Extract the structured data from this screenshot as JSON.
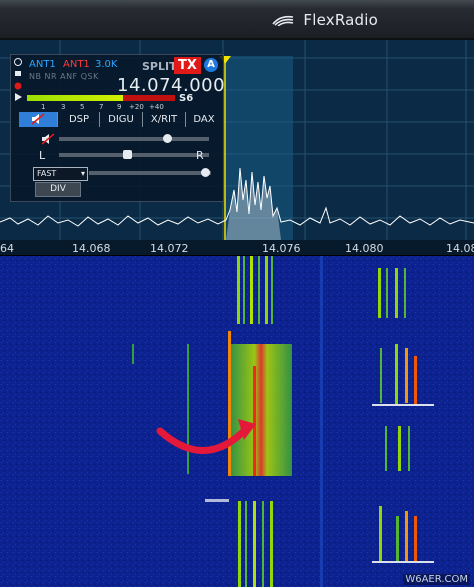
{
  "app": {
    "brand": "FlexRadio"
  },
  "slice": {
    "rx_ant": "ANT1",
    "tx_ant": "ANT1",
    "filter": "3.0K",
    "flags": "NB NR ANF QSK",
    "split_label": "SPLIT",
    "tx_label": "TX",
    "slice_letter": "A",
    "frequency": "14.074.000",
    "s_meter": "S6",
    "s_meter_fraction": 0.65,
    "meter_scale": [
      "1",
      "3",
      "5",
      "7",
      "9",
      "+20",
      "+40"
    ],
    "tabs": [
      "DSP",
      "DIGU",
      "X/RIT",
      "DAX"
    ],
    "pan_left": "L",
    "pan_right": "R",
    "agc_mode": "FAST",
    "div_label": "DIV",
    "audio_gain_fraction": 0.72,
    "pan_fraction": 0.45,
    "agc_threshold_fraction": 0.95
  },
  "freq_axis": [
    "64",
    "14.068",
    "14.072",
    "14.076",
    "14.080",
    "14.08"
  ],
  "watermark": "W6AER.COM",
  "colors": {
    "accent": "#2f7fd8",
    "tx": "#e01919",
    "panadapter_bg": "#0a2a45",
    "waterfall_bg": "#0b1f84"
  }
}
